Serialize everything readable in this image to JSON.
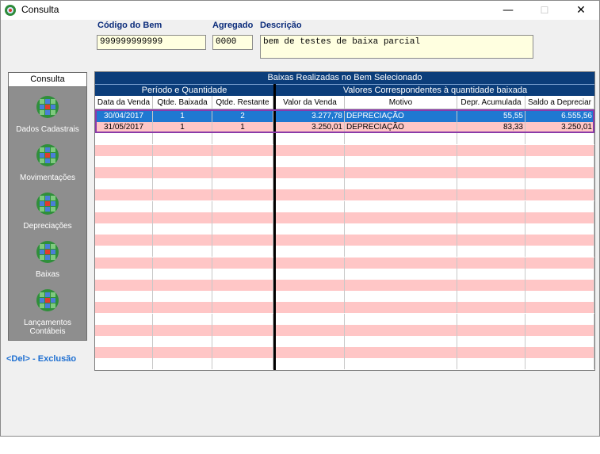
{
  "window": {
    "title": "Consulta",
    "close_label": "✕",
    "minimize_label": "—",
    "maximize_label": "☐"
  },
  "fields": {
    "codigo_label": "Código do Bem",
    "codigo_value": "999999999999",
    "agregado_label": "Agregado",
    "agregado_value": "0000",
    "descricao_label": "Descrição",
    "descricao_value": "bem de testes  de  baixa parcial"
  },
  "sidebar": {
    "tab": "Consulta",
    "items": [
      {
        "label": "Dados Cadastrais"
      },
      {
        "label": "Movimentações"
      },
      {
        "label": "Depreciações"
      },
      {
        "label": "Baixas"
      },
      {
        "label": "Lançamentos Contábeis"
      }
    ]
  },
  "hint": "<Del> - Exclusão",
  "grid": {
    "title": "Baixas Realizadas no Bem Selecionado",
    "group_left": "Período e Quantidade",
    "group_right": "Valores Correspondentes à quantidade baixada",
    "columns": [
      "Data da Venda",
      "Qtde. Baixada",
      "Qtde. Restante",
      "Valor da Venda",
      "Motivo",
      "Depr. Acumulada",
      "Saldo a Depreciar"
    ],
    "rows": [
      [
        "30/04/2017",
        "1",
        "2",
        "3.277,78",
        "DEPRECIAÇÃO",
        "55,55",
        "6.555,56"
      ],
      [
        "31/05/2017",
        "1",
        "1",
        "3.250,01",
        "DEPRECIAÇÃO",
        "83,33",
        "3.250,01"
      ]
    ],
    "selected_row": 0
  },
  "colors": {
    "header": "#0b3d7a",
    "selected": "#1f78d1",
    "stripe": "#ffc6c6",
    "label": "#0a2b7a",
    "hint": "#1e6fd1"
  }
}
